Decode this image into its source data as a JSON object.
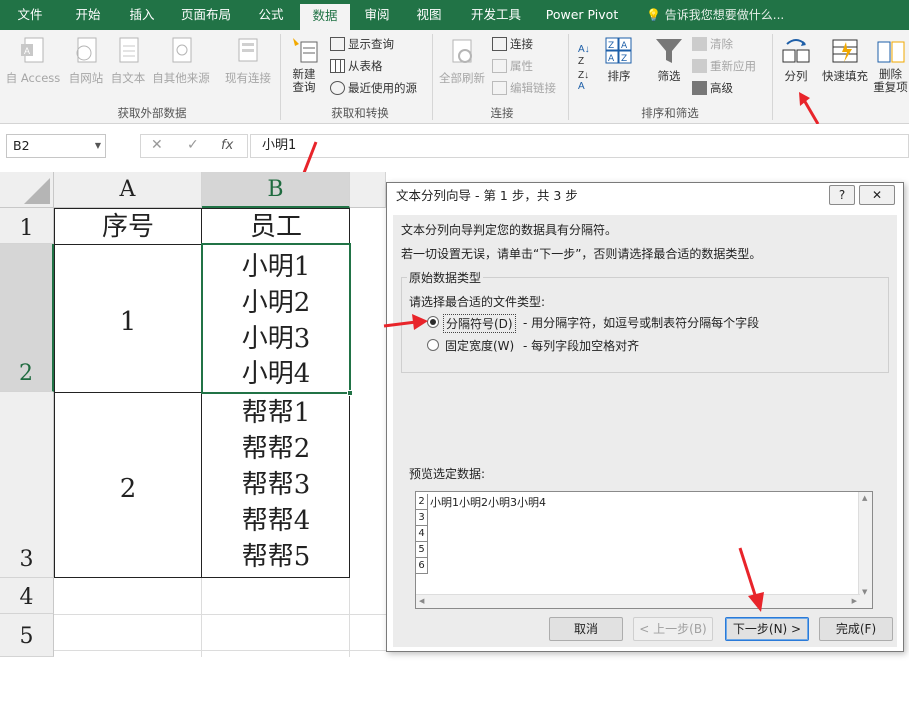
{
  "tabs": [
    "文件",
    "开始",
    "插入",
    "页面布局",
    "公式",
    "数据",
    "审阅",
    "视图",
    "开发工具",
    "Power Pivot"
  ],
  "active_tab": "数据",
  "tell_me": "告诉我您想要做什么...",
  "ribbon": {
    "external": {
      "access": "自 Access",
      "web": "自网站",
      "text": "自文本",
      "other": "自其他来源",
      "existing": "现有连接",
      "group": "获取外部数据"
    },
    "transform": {
      "new_query_1": "新建",
      "new_query_2": "查询",
      "show_queries": "显示查询",
      "from_table": "从表格",
      "recent": "最近使用的源",
      "group": "获取和转换"
    },
    "connections": {
      "refresh_all": "全部刷新",
      "connections": "连接",
      "properties": "属性",
      "edit_links": "编辑链接",
      "group": "连接"
    },
    "sort_filter": {
      "sort": "排序",
      "filter": "筛选",
      "clear": "清除",
      "reapply": "重新应用",
      "advanced": "高级",
      "group": "排序和筛选"
    },
    "tools": {
      "text_to_columns": "分列",
      "flash_fill": "快速填充",
      "remove_dup_1": "删除",
      "remove_dup_2": "重复项"
    }
  },
  "formula_bar": {
    "name_box": "B2",
    "content": "小明1",
    "fx": "fx",
    "cancel": "✕",
    "enter": "✓"
  },
  "sheet": {
    "columns": [
      "A",
      "B"
    ],
    "rows": [
      "1",
      "2",
      "3",
      "4",
      "5"
    ],
    "header_a": "序号",
    "header_b": "员工",
    "a2": "1",
    "b2": [
      "小明1",
      "小明2",
      "小明3",
      "小明4"
    ],
    "a3": "2",
    "b3": [
      "帮帮1",
      "帮帮2",
      "帮帮3",
      "帮帮4",
      "帮帮5"
    ]
  },
  "dialog": {
    "title": "文本分列向导 - 第 1 步，共 3 步",
    "help": "?",
    "close": "✕",
    "line1": "文本分列向导判定您的数据具有分隔符。",
    "line2": "若一切设置无误，请单击“下一步”，否则请选择最合适的数据类型。",
    "group_title": "原始数据类型",
    "prompt": "请选择最合适的文件类型:",
    "opt_delimited": "分隔符号(D)",
    "opt_delimited_desc": "- 用分隔字符，如逗号或制表符分隔每个字段",
    "opt_fixed": "固定宽度(W)",
    "opt_fixed_desc": "- 每列字段加空格对齐",
    "preview_label": "预览选定数据:",
    "preview_rows": [
      "2",
      "3",
      "4",
      "5",
      "6"
    ],
    "preview_line": "小明1小明2小明3小明4",
    "buttons": {
      "cancel": "取消",
      "back": "< 上一步(B)",
      "next": "下一步(N) >",
      "finish": "完成(F)"
    }
  },
  "colors": {
    "accent": "#217346",
    "annotation_arrow": "#e8242a",
    "selection": "#217346"
  }
}
